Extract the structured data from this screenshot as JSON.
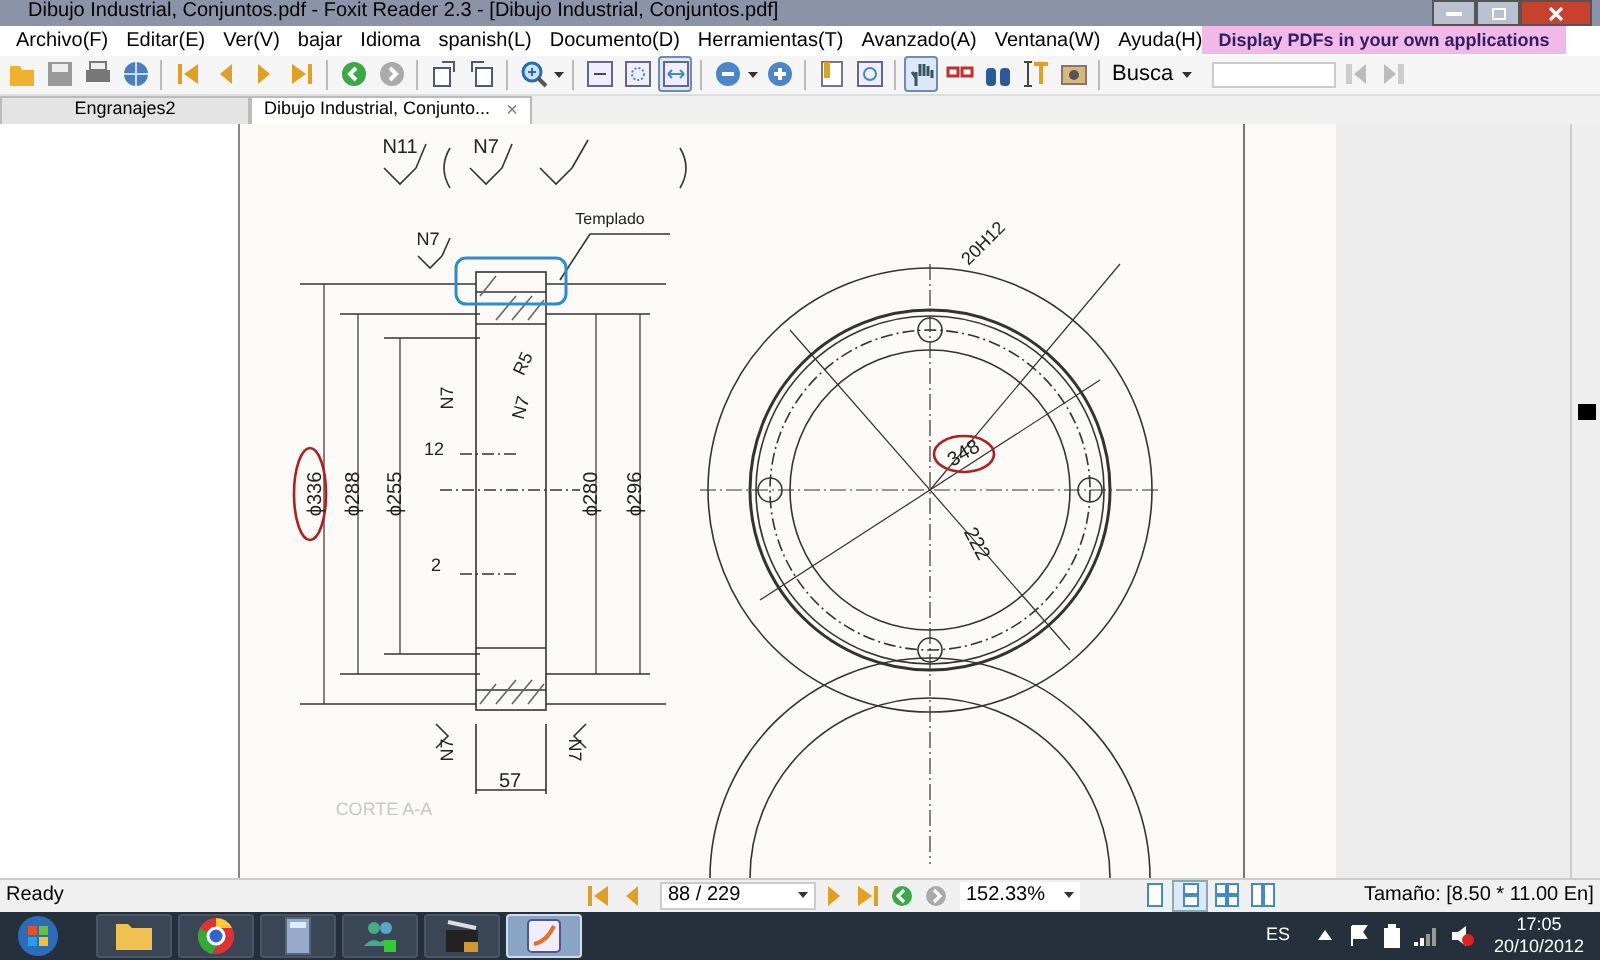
{
  "window": {
    "title": "Dibujo Industrial, Conjuntos.pdf - Foxit Reader 2.3 - [Dibujo Industrial, Conjuntos.pdf]"
  },
  "menu": [
    "Archivo(F)",
    "Editar(E)",
    "Ver(V)",
    "bajar",
    "Idioma",
    "spanish(L)",
    "Documento(D)",
    "Herramientas(T)",
    "Avanzado(A)",
    "Ventana(W)",
    "Ayuda(H)"
  ],
  "ad_banner": "Display PDFs in your own applications",
  "toolbar": {
    "zoom_modes": [
      {
        "selected": false
      },
      {
        "selected": false
      },
      {
        "selected": true
      }
    ],
    "tools": [
      {
        "selected": true
      },
      {
        "selected": false
      },
      {
        "selected": false
      },
      {
        "selected": false
      },
      {
        "selected": false
      }
    ],
    "search_label": "Busca"
  },
  "tabs": [
    {
      "label": "Engranajes2",
      "selected": false
    },
    {
      "label": "Dibujo Industrial, Conjunto...",
      "selected": true,
      "close": "×"
    }
  ],
  "drawing": {
    "labels": [
      {
        "text": "N11",
        "circled": false
      },
      {
        "text": "N7",
        "circled": false
      },
      {
        "text": "Templado",
        "circled": false
      },
      {
        "text": "N7",
        "circled": false
      },
      {
        "text": "20H12",
        "circled": false
      },
      {
        "text": "R5",
        "circled": false
      },
      {
        "text": "N7",
        "circled": false
      },
      {
        "text": "N7",
        "circled": false
      },
      {
        "text": "12",
        "circled": false
      },
      {
        "text": "ϕ336",
        "circled": true
      },
      {
        "text": "ϕ288",
        "circled": false
      },
      {
        "text": "ϕ255",
        "circled": false
      },
      {
        "text": "ϕ280",
        "circled": false
      },
      {
        "text": "ϕ296",
        "circled": false
      },
      {
        "text": "348",
        "circled": true
      },
      {
        "text": "222",
        "circled": false
      },
      {
        "text": "2",
        "circled": false
      },
      {
        "text": "N7",
        "circled": false
      },
      {
        "text": "N7",
        "circled": false
      },
      {
        "text": "57",
        "circled": false
      },
      {
        "text": "CORTE A-A",
        "circled": false
      }
    ]
  },
  "status_bar": {
    "status": "Ready",
    "page": "88 / 229",
    "zoom": "152.33%",
    "view_modes": [
      {
        "selected": false
      },
      {
        "selected": true
      },
      {
        "selected": false
      },
      {
        "selected": false
      }
    ],
    "page_size": "Tamaño: [8.50 * 11.00 En]"
  },
  "taskbar": {
    "apps": [
      {
        "selected": false
      },
      {
        "selected": false
      },
      {
        "selected": false
      },
      {
        "selected": false
      },
      {
        "selected": false
      },
      {
        "selected": true
      }
    ],
    "language": "ES",
    "time": "17:05",
    "date": "20/10/2012"
  }
}
